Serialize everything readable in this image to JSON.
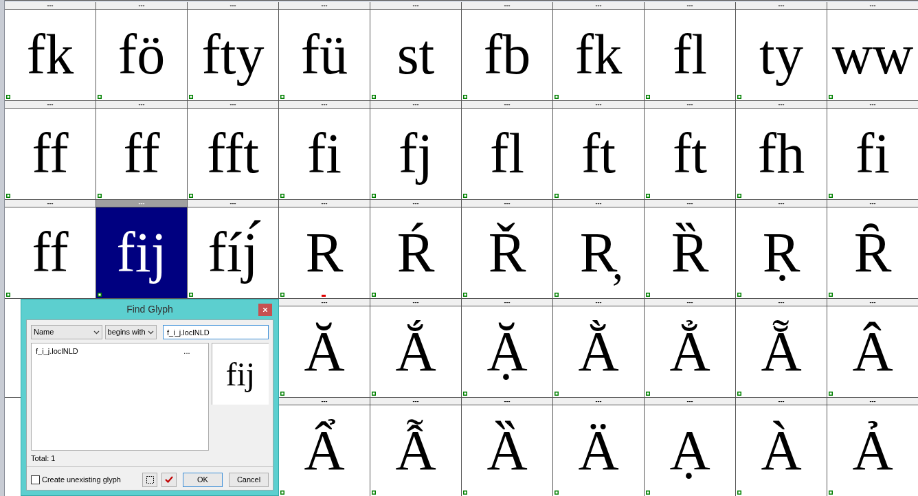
{
  "grid": {
    "rows": [
      [
        {
          "header": "---",
          "glyph": "fk",
          "selected": false,
          "flagged": false
        },
        {
          "header": "---",
          "glyph": "fö",
          "selected": false,
          "flagged": false
        },
        {
          "header": "---",
          "glyph": "fty",
          "selected": false,
          "flagged": false
        },
        {
          "header": "---",
          "glyph": "fü",
          "selected": false,
          "flagged": false
        },
        {
          "header": "---",
          "glyph": "st",
          "selected": false,
          "flagged": false
        },
        {
          "header": "---",
          "glyph": "fb",
          "selected": false,
          "flagged": false
        },
        {
          "header": "---",
          "glyph": "fk",
          "selected": false,
          "flagged": false
        },
        {
          "header": "---",
          "glyph": "fl",
          "selected": false,
          "flagged": false
        },
        {
          "header": "---",
          "glyph": "ty",
          "selected": false,
          "flagged": false
        },
        {
          "header": "---",
          "glyph": "ww",
          "selected": false,
          "flagged": false
        }
      ],
      [
        {
          "header": "---",
          "glyph": "ff",
          "selected": false,
          "flagged": false
        },
        {
          "header": "---",
          "glyph": "ff",
          "selected": false,
          "flagged": false
        },
        {
          "header": "---",
          "glyph": "fft",
          "selected": false,
          "flagged": false
        },
        {
          "header": "---",
          "glyph": "fi",
          "selected": false,
          "flagged": false
        },
        {
          "header": "---",
          "glyph": "fj",
          "selected": false,
          "flagged": false
        },
        {
          "header": "---",
          "glyph": "fl",
          "selected": false,
          "flagged": false
        },
        {
          "header": "---",
          "glyph": "ft",
          "selected": false,
          "flagged": false
        },
        {
          "header": "---",
          "glyph": "ft",
          "selected": false,
          "flagged": false
        },
        {
          "header": "---",
          "glyph": "fh",
          "selected": false,
          "flagged": false
        },
        {
          "header": "---",
          "glyph": "fi",
          "selected": false,
          "flagged": false
        }
      ],
      [
        {
          "header": "---",
          "glyph": "ff",
          "selected": false,
          "flagged": false
        },
        {
          "header": "---",
          "glyph": "fij",
          "selected": true,
          "flagged": false
        },
        {
          "header": "---",
          "glyph": "fíj́",
          "selected": false,
          "flagged": false
        },
        {
          "header": "---",
          "glyph": "R",
          "selected": false,
          "flagged": true
        },
        {
          "header": "---",
          "glyph": "Ŕ",
          "selected": false,
          "flagged": false
        },
        {
          "header": "---",
          "glyph": "Ř",
          "selected": false,
          "flagged": false
        },
        {
          "header": "---",
          "glyph": "R̦",
          "selected": false,
          "flagged": false
        },
        {
          "header": "---",
          "glyph": "Ȑ",
          "selected": false,
          "flagged": false
        },
        {
          "header": "---",
          "glyph": "Ṛ",
          "selected": false,
          "flagged": false
        },
        {
          "header": "---",
          "glyph": "Ȓ",
          "selected": false,
          "flagged": false
        }
      ],
      [
        {
          "header": "---",
          "glyph": "Ă",
          "selected": false,
          "flagged": false
        },
        {
          "header": "---",
          "glyph": "Ắ",
          "selected": false,
          "flagged": false
        },
        {
          "header": "---",
          "glyph": "Ặ",
          "selected": false,
          "flagged": false
        },
        {
          "header": "---",
          "glyph": "Ằ",
          "selected": false,
          "flagged": false
        },
        {
          "header": "---",
          "glyph": "Ẳ",
          "selected": false,
          "flagged": false
        },
        {
          "header": "---",
          "glyph": "Ẵ",
          "selected": false,
          "flagged": false
        },
        {
          "header": "---",
          "glyph": "Â",
          "selected": false,
          "flagged": false
        }
      ],
      [
        {
          "header": "---",
          "glyph": "Ẩ",
          "selected": false,
          "flagged": false
        },
        {
          "header": "---",
          "glyph": "Ẫ",
          "selected": false,
          "flagged": false
        },
        {
          "header": "---",
          "glyph": "Ȁ",
          "selected": false,
          "flagged": false
        },
        {
          "header": "---",
          "glyph": "Ä",
          "selected": false,
          "flagged": false
        },
        {
          "header": "---",
          "glyph": "Ạ",
          "selected": false,
          "flagged": false
        },
        {
          "header": "---",
          "glyph": "À",
          "selected": false,
          "flagged": false
        },
        {
          "header": "---",
          "glyph": "Ả",
          "selected": false,
          "flagged": false
        }
      ]
    ]
  },
  "dialog": {
    "title": "Find Glyph",
    "field": "Name",
    "condition": "begins with",
    "search": "f_i_j.loclNLD",
    "results": [
      {
        "name": "f_i_j.loclNLD",
        "extra": "..."
      }
    ],
    "preview": "fij",
    "total": "Total: 1",
    "checkbox": {
      "label": "Create unexisting glyph",
      "checked": false
    },
    "buttons": [
      "OK",
      "Cancel"
    ]
  }
}
